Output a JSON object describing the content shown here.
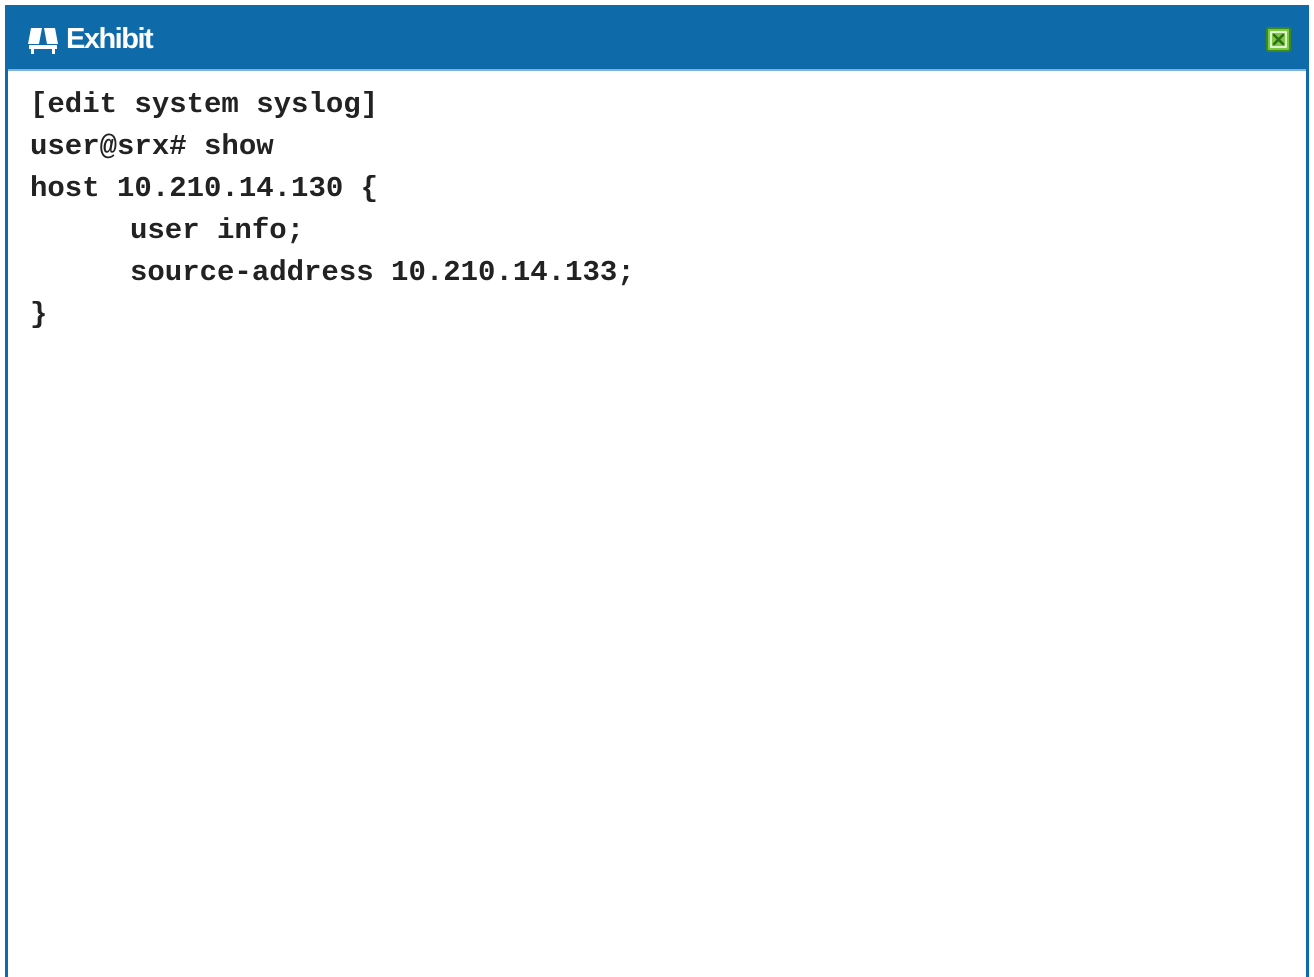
{
  "window": {
    "title": "Exhibit",
    "title_icon": "exhibit-icon",
    "close_icon": "close-icon"
  },
  "content": {
    "lines": [
      "[edit system syslog]",
      "user@srx# show",
      "host 10.210.14.130 {",
      "user info;",
      "source-address 10.210.14.133;",
      "}"
    ]
  },
  "colors": {
    "titlebar": "#0e6aa8",
    "title_text": "#ffffff",
    "close_button_fill": "#7ac943",
    "close_button_border": "#3c8a1e"
  }
}
